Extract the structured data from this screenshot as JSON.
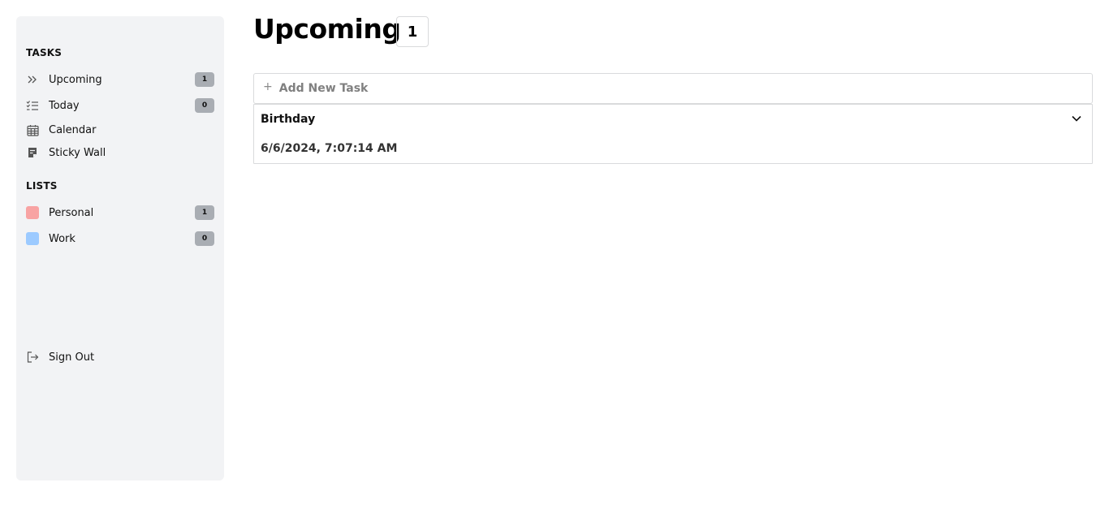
{
  "sidebar": {
    "tasks_heading": "TASKS",
    "tasks": [
      {
        "label": "Upcoming",
        "icon": "double-chevron-right-icon",
        "count": "1"
      },
      {
        "label": "Today",
        "icon": "checklist-icon",
        "count": "0"
      },
      {
        "label": "Calendar",
        "icon": "calendar-icon"
      },
      {
        "label": "Sticky Wall",
        "icon": "sticky-note-icon"
      }
    ],
    "lists_heading": "LISTS",
    "lists": [
      {
        "label": "Personal",
        "color": "#f8a3a3",
        "count": "1"
      },
      {
        "label": "Work",
        "color": "#9ccaff",
        "count": "0"
      }
    ],
    "sign_out": {
      "label": "Sign Out",
      "icon": "sign-out-icon"
    }
  },
  "main": {
    "title": "Upcoming",
    "count": "1",
    "add_task": {
      "icon": "plus-icon",
      "label": "Add New Task"
    },
    "tasks": [
      {
        "title": "Birthday",
        "date": "6/6/2024, 7:07:14 AM",
        "toggle_icon": "chevron-down-icon"
      }
    ]
  },
  "colors": {
    "sidebar_bg": "#f2f3f5",
    "badge_bg": "#a9adb3",
    "border": "#d9dadc"
  }
}
